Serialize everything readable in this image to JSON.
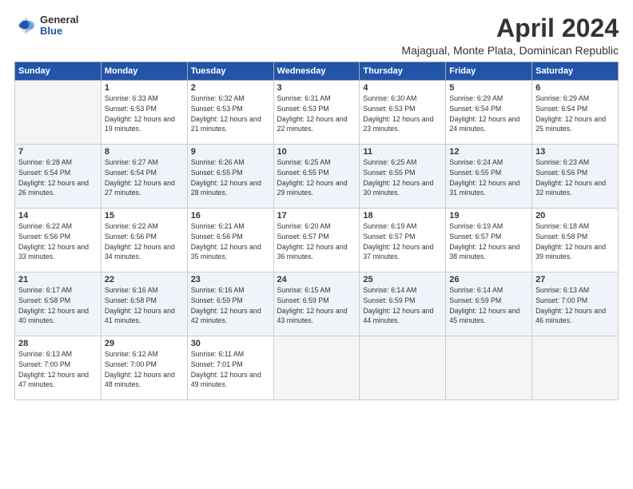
{
  "logo": {
    "general": "General",
    "blue": "Blue"
  },
  "title": "April 2024",
  "subtitle": "Majagual, Monte Plata, Dominican Republic",
  "days_header": [
    "Sunday",
    "Monday",
    "Tuesday",
    "Wednesday",
    "Thursday",
    "Friday",
    "Saturday"
  ],
  "weeks": [
    [
      {
        "day": "",
        "empty": true
      },
      {
        "day": "1",
        "sunrise": "Sunrise: 6:33 AM",
        "sunset": "Sunset: 6:53 PM",
        "daylight": "Daylight: 12 hours and 19 minutes."
      },
      {
        "day": "2",
        "sunrise": "Sunrise: 6:32 AM",
        "sunset": "Sunset: 6:53 PM",
        "daylight": "Daylight: 12 hours and 21 minutes."
      },
      {
        "day": "3",
        "sunrise": "Sunrise: 6:31 AM",
        "sunset": "Sunset: 6:53 PM",
        "daylight": "Daylight: 12 hours and 22 minutes."
      },
      {
        "day": "4",
        "sunrise": "Sunrise: 6:30 AM",
        "sunset": "Sunset: 6:53 PM",
        "daylight": "Daylight: 12 hours and 23 minutes."
      },
      {
        "day": "5",
        "sunrise": "Sunrise: 6:29 AM",
        "sunset": "Sunset: 6:54 PM",
        "daylight": "Daylight: 12 hours and 24 minutes."
      },
      {
        "day": "6",
        "sunrise": "Sunrise: 6:29 AM",
        "sunset": "Sunset: 6:54 PM",
        "daylight": "Daylight: 12 hours and 25 minutes."
      }
    ],
    [
      {
        "day": "7",
        "sunrise": "Sunrise: 6:28 AM",
        "sunset": "Sunset: 6:54 PM",
        "daylight": "Daylight: 12 hours and 26 minutes."
      },
      {
        "day": "8",
        "sunrise": "Sunrise: 6:27 AM",
        "sunset": "Sunset: 6:54 PM",
        "daylight": "Daylight: 12 hours and 27 minutes."
      },
      {
        "day": "9",
        "sunrise": "Sunrise: 6:26 AM",
        "sunset": "Sunset: 6:55 PM",
        "daylight": "Daylight: 12 hours and 28 minutes."
      },
      {
        "day": "10",
        "sunrise": "Sunrise: 6:25 AM",
        "sunset": "Sunset: 6:55 PM",
        "daylight": "Daylight: 12 hours and 29 minutes."
      },
      {
        "day": "11",
        "sunrise": "Sunrise: 6:25 AM",
        "sunset": "Sunset: 6:55 PM",
        "daylight": "Daylight: 12 hours and 30 minutes."
      },
      {
        "day": "12",
        "sunrise": "Sunrise: 6:24 AM",
        "sunset": "Sunset: 6:55 PM",
        "daylight": "Daylight: 12 hours and 31 minutes."
      },
      {
        "day": "13",
        "sunrise": "Sunrise: 6:23 AM",
        "sunset": "Sunset: 6:56 PM",
        "daylight": "Daylight: 12 hours and 32 minutes."
      }
    ],
    [
      {
        "day": "14",
        "sunrise": "Sunrise: 6:22 AM",
        "sunset": "Sunset: 6:56 PM",
        "daylight": "Daylight: 12 hours and 33 minutes."
      },
      {
        "day": "15",
        "sunrise": "Sunrise: 6:22 AM",
        "sunset": "Sunset: 6:56 PM",
        "daylight": "Daylight: 12 hours and 34 minutes."
      },
      {
        "day": "16",
        "sunrise": "Sunrise: 6:21 AM",
        "sunset": "Sunset: 6:56 PM",
        "daylight": "Daylight: 12 hours and 35 minutes."
      },
      {
        "day": "17",
        "sunrise": "Sunrise: 6:20 AM",
        "sunset": "Sunset: 6:57 PM",
        "daylight": "Daylight: 12 hours and 36 minutes."
      },
      {
        "day": "18",
        "sunrise": "Sunrise: 6:19 AM",
        "sunset": "Sunset: 6:57 PM",
        "daylight": "Daylight: 12 hours and 37 minutes."
      },
      {
        "day": "19",
        "sunrise": "Sunrise: 6:19 AM",
        "sunset": "Sunset: 6:57 PM",
        "daylight": "Daylight: 12 hours and 38 minutes."
      },
      {
        "day": "20",
        "sunrise": "Sunrise: 6:18 AM",
        "sunset": "Sunset: 6:58 PM",
        "daylight": "Daylight: 12 hours and 39 minutes."
      }
    ],
    [
      {
        "day": "21",
        "sunrise": "Sunrise: 6:17 AM",
        "sunset": "Sunset: 6:58 PM",
        "daylight": "Daylight: 12 hours and 40 minutes."
      },
      {
        "day": "22",
        "sunrise": "Sunrise: 6:16 AM",
        "sunset": "Sunset: 6:58 PM",
        "daylight": "Daylight: 12 hours and 41 minutes."
      },
      {
        "day": "23",
        "sunrise": "Sunrise: 6:16 AM",
        "sunset": "Sunset: 6:59 PM",
        "daylight": "Daylight: 12 hours and 42 minutes."
      },
      {
        "day": "24",
        "sunrise": "Sunrise: 6:15 AM",
        "sunset": "Sunset: 6:59 PM",
        "daylight": "Daylight: 12 hours and 43 minutes."
      },
      {
        "day": "25",
        "sunrise": "Sunrise: 6:14 AM",
        "sunset": "Sunset: 6:59 PM",
        "daylight": "Daylight: 12 hours and 44 minutes."
      },
      {
        "day": "26",
        "sunrise": "Sunrise: 6:14 AM",
        "sunset": "Sunset: 6:59 PM",
        "daylight": "Daylight: 12 hours and 45 minutes."
      },
      {
        "day": "27",
        "sunrise": "Sunrise: 6:13 AM",
        "sunset": "Sunset: 7:00 PM",
        "daylight": "Daylight: 12 hours and 46 minutes."
      }
    ],
    [
      {
        "day": "28",
        "sunrise": "Sunrise: 6:13 AM",
        "sunset": "Sunset: 7:00 PM",
        "daylight": "Daylight: 12 hours and 47 minutes."
      },
      {
        "day": "29",
        "sunrise": "Sunrise: 6:12 AM",
        "sunset": "Sunset: 7:00 PM",
        "daylight": "Daylight: 12 hours and 48 minutes."
      },
      {
        "day": "30",
        "sunrise": "Sunrise: 6:11 AM",
        "sunset": "Sunset: 7:01 PM",
        "daylight": "Daylight: 12 hours and 49 minutes."
      },
      {
        "day": "",
        "empty": true
      },
      {
        "day": "",
        "empty": true
      },
      {
        "day": "",
        "empty": true
      },
      {
        "day": "",
        "empty": true
      }
    ]
  ]
}
